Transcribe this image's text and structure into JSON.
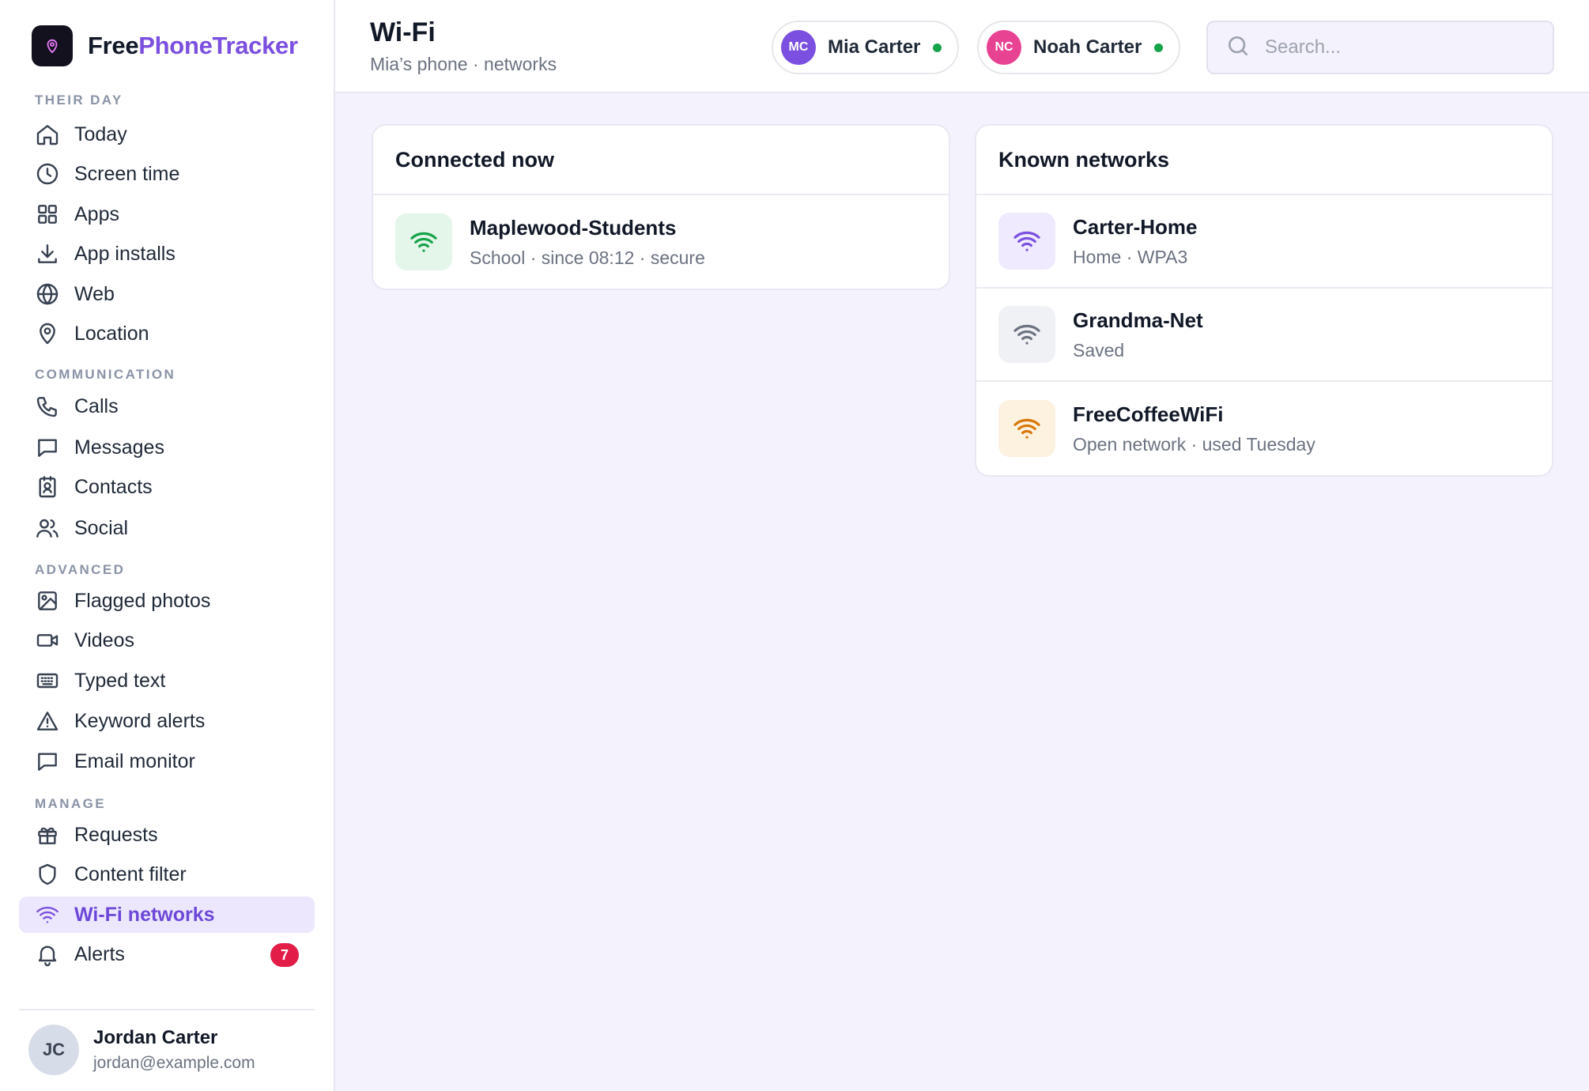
{
  "brand": {
    "part1": "Free",
    "part2": "PhoneTracker"
  },
  "sidebar": {
    "sections": [
      {
        "label": "THEIR DAY",
        "items": [
          {
            "label": "Today",
            "icon": "home-icon"
          },
          {
            "label": "Screen time",
            "icon": "clock-icon"
          },
          {
            "label": "Apps",
            "icon": "apps-grid-icon"
          },
          {
            "label": "App installs",
            "icon": "download-icon"
          },
          {
            "label": "Web",
            "icon": "globe-icon"
          },
          {
            "label": "Location",
            "icon": "map-pin-icon"
          }
        ]
      },
      {
        "label": "COMMUNICATION",
        "items": [
          {
            "label": "Calls",
            "icon": "phone-icon"
          },
          {
            "label": "Messages",
            "icon": "message-icon"
          },
          {
            "label": "Contacts",
            "icon": "contact-card-icon"
          },
          {
            "label": "Social",
            "icon": "users-icon"
          }
        ]
      },
      {
        "label": "ADVANCED",
        "items": [
          {
            "label": "Flagged photos",
            "icon": "image-icon"
          },
          {
            "label": "Videos",
            "icon": "video-icon"
          },
          {
            "label": "Typed text",
            "icon": "keyboard-icon"
          },
          {
            "label": "Keyword alerts",
            "icon": "warning-icon"
          },
          {
            "label": "Email monitor",
            "icon": "message-icon"
          }
        ]
      },
      {
        "label": "MANAGE",
        "items": [
          {
            "label": "Requests",
            "icon": "gift-icon"
          },
          {
            "label": "Content filter",
            "icon": "shield-icon"
          },
          {
            "label": "Wi-Fi networks",
            "icon": "wifi-icon",
            "active": true
          },
          {
            "label": "Alerts",
            "icon": "bell-icon",
            "badge": "7"
          }
        ]
      }
    ]
  },
  "user": {
    "initials": "JC",
    "name": "Jordan Carter",
    "email": "jordan@example.com"
  },
  "header": {
    "title": "Wi-Fi",
    "subtitle": "Mia’s phone · networks",
    "children": [
      {
        "initials": "MC",
        "name": "Mia Carter",
        "active": true,
        "color": "#7b4fe0"
      },
      {
        "initials": "NC",
        "name": "Noah Carter",
        "active": false,
        "color": "#e84393"
      }
    ],
    "search_placeholder": "Search..."
  },
  "connected": {
    "title": "Connected now",
    "networks": [
      {
        "name": "Maplewood-Students",
        "meta": "School · since 08:12 · secure",
        "tint": "#e3f6e9",
        "color": "#16a34a"
      }
    ]
  },
  "known": {
    "title": "Known networks",
    "networks": [
      {
        "name": "Carter-Home",
        "meta": "Home · WPA3",
        "tint": "#efeafd",
        "color": "#7b4fe0"
      },
      {
        "name": "Grandma-Net",
        "meta": "Saved",
        "tint": "#f0f1f5",
        "color": "#6b7280"
      },
      {
        "name": "FreeCoffeeWiFi",
        "meta": "Open network · used Tuesday",
        "tint": "#fdf1df",
        "color": "#d97706"
      }
    ]
  }
}
